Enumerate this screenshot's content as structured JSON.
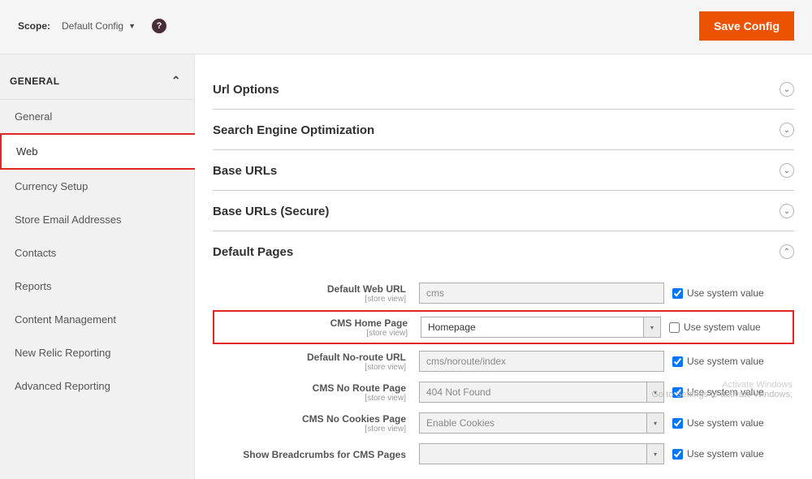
{
  "topbar": {
    "scope_label": "Scope:",
    "scope_value": "Default Config",
    "save_button": "Save Config"
  },
  "sidebar": {
    "group_header": "GENERAL",
    "items": [
      "General",
      "Web",
      "Currency Setup",
      "Store Email Addresses",
      "Contacts",
      "Reports",
      "Content Management",
      "New Relic Reporting",
      "Advanced Reporting"
    ]
  },
  "sections": {
    "url_options": "Url Options",
    "seo": "Search Engine Optimization",
    "base_urls": "Base URLs",
    "base_urls_secure": "Base URLs (Secure)",
    "default_pages": "Default Pages"
  },
  "fields": {
    "scope_text": "[store view]",
    "use_system": "Use system value",
    "default_web_url": {
      "label": "Default Web URL",
      "value": "cms"
    },
    "cms_home_page": {
      "label": "CMS Home Page",
      "value": "Homepage"
    },
    "default_noroute_url": {
      "label": "Default No-route URL",
      "value": "cms/noroute/index"
    },
    "cms_no_route_page": {
      "label": "CMS No Route Page",
      "value": "404 Not Found"
    },
    "cms_no_cookies_page": {
      "label": "CMS No Cookies Page",
      "value": "Enable Cookies"
    },
    "show_breadcrumbs": {
      "label": "Show Breadcrumbs for CMS Pages"
    }
  },
  "watermark": {
    "line1": "Activate Windows",
    "line2": "Go to Settings to activate Windows."
  }
}
